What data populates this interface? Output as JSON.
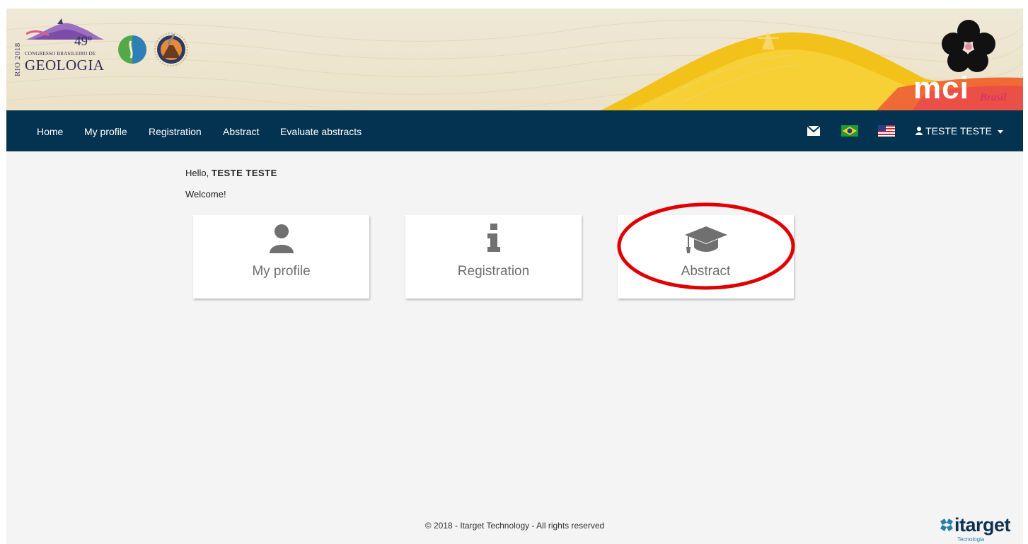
{
  "banner": {
    "event_year_text": "RIO 2018",
    "event_number": "49º",
    "event_subtitle": "CONGRESSO BRASILEIRO DE",
    "event_name": "GEOLOGIA",
    "sponsor_logo": "mci",
    "sponsor_sublabel": "Brasil"
  },
  "nav": {
    "items": [
      {
        "label": "Home"
      },
      {
        "label": "My profile"
      },
      {
        "label": "Registration"
      },
      {
        "label": "Abstract"
      },
      {
        "label": "Evaluate abstracts"
      }
    ],
    "icons": [
      "envelope-icon",
      "brazil-flag-icon",
      "usa-flag-icon"
    ],
    "user_name": "TESTE TESTE"
  },
  "content": {
    "greeting_prefix": "Hello,",
    "greeting_name": "TESTE TESTE",
    "welcome": "Welcome!",
    "cards": [
      {
        "label": "My profile",
        "icon": "user-icon"
      },
      {
        "label": "Registration",
        "icon": "info-icon"
      },
      {
        "label": "Abstract",
        "icon": "graduation-cap-icon"
      }
    ]
  },
  "footer": {
    "copyright": "© 2018 - Itarget Technology - All rights reserved",
    "brand": "itarget",
    "brand_tagline": "Tecnologia"
  },
  "colors": {
    "navbar": "#033350",
    "page_bg": "#f4f4f4",
    "highlight_ring": "#e00000",
    "card_text": "#6e6e6e"
  }
}
